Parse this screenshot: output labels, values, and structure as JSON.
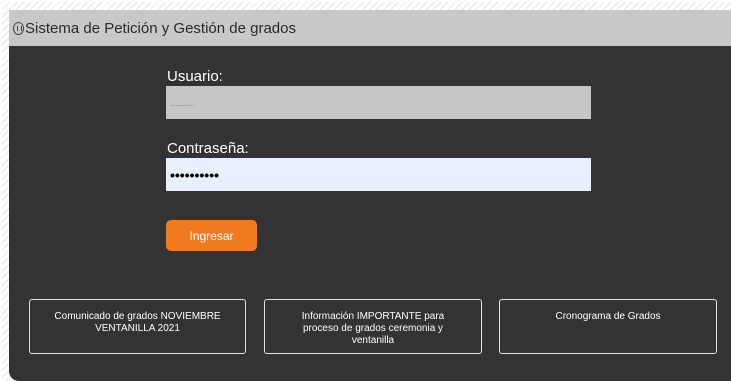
{
  "header": {
    "title": "Sistema de Petición y Gestión de grados",
    "icon": "info-icon"
  },
  "login": {
    "username_label": "Usuario:",
    "username_value": "..........",
    "password_label": "Contraseña:",
    "password_value": "••••••••••",
    "submit_label": "Ingresar"
  },
  "links": [
    {
      "label": "Comunicado de grados NOVIEMBRE VENTANILLA 2021"
    },
    {
      "label": "Información IMPORTANTE para proceso de grados ceremonia y ventanilla"
    },
    {
      "label": "Cronograma de Grados"
    }
  ],
  "colors": {
    "panel": "#333333",
    "titlebar": "#c8c8c8",
    "accent": "#f07a1e"
  }
}
